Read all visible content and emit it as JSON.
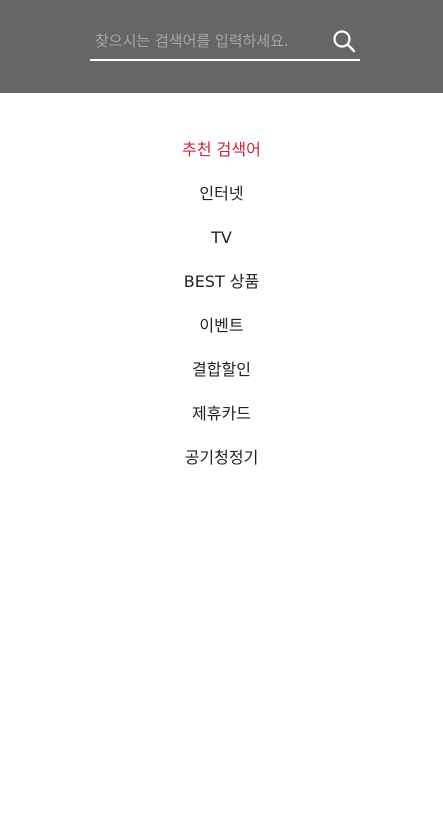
{
  "search": {
    "placeholder": "찾으시는 검색어를 입력하세요.",
    "value": "",
    "button_icon": "search-icon"
  },
  "recommend": {
    "title": "추천 검색어",
    "title_color": "#d4213a",
    "items": [
      {
        "label": "인터넷"
      },
      {
        "label": "TV"
      },
      {
        "label": "BEST 상품"
      },
      {
        "label": "이벤트"
      },
      {
        "label": "결합할인"
      },
      {
        "label": "제휴카드"
      },
      {
        "label": "공기청정기"
      }
    ]
  },
  "colors": {
    "header_bg": "#666666",
    "underline": "#ffffff"
  }
}
